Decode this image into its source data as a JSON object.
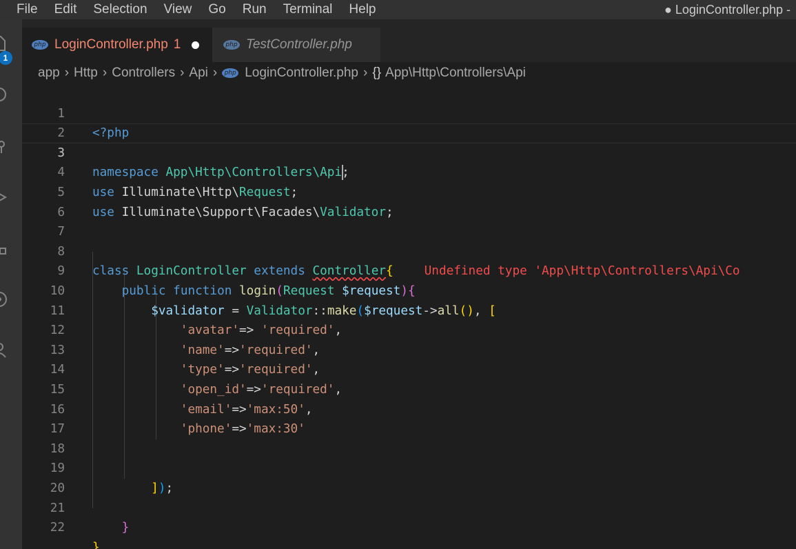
{
  "menu": {
    "items": [
      "File",
      "Edit",
      "Selection",
      "View",
      "Go",
      "Run",
      "Terminal",
      "Help"
    ],
    "window_title": "● LoginController.php -"
  },
  "activity_bar": {
    "badge_count": "1",
    "icons": [
      "explorer-icon",
      "search-icon",
      "source-control-icon",
      "run-debug-icon",
      "extensions-icon",
      "remote-icon",
      "accounts-icon"
    ]
  },
  "tabs": [
    {
      "icon": "php",
      "label": "LoginController.php",
      "problems": "1",
      "dirty": true,
      "active": true
    },
    {
      "icon": "php",
      "label": "TestController.php",
      "active": false
    }
  ],
  "breadcrumb": {
    "segments": [
      "app",
      "Http",
      "Controllers",
      "Api"
    ],
    "file_icon": "php",
    "file": "LoginController.php",
    "symbol_icon": "{}",
    "symbol": "App\\Http\\Controllers\\Api"
  },
  "editor": {
    "current_line": 3,
    "line_numbers": [
      "1",
      "2",
      "3",
      "4",
      "5",
      "6",
      "7",
      "8",
      "9",
      "10",
      "11",
      "12",
      "13",
      "14",
      "15",
      "16",
      "17",
      "18",
      "19",
      "20",
      "21",
      "22"
    ],
    "code": {
      "l1_open": "<?php",
      "l3_keyword": "namespace",
      "l3_ns": "App\\Http\\Controllers\\Api",
      "l3_semi": ";",
      "l4_use": "use",
      "l4_path": "Illuminate\\Http\\",
      "l4_class": "Request",
      "l4_semi": ";",
      "l5_use": "use",
      "l5_path": "Illuminate\\Support\\Facades\\",
      "l5_class": "Validator",
      "l5_semi": ";",
      "l8_class_kw": "class",
      "l8_name": "LoginController",
      "l8_extends": "extends",
      "l8_parent": "Controller",
      "l8_brace": "{",
      "l8_diagnostic": "Undefined type 'App\\Http\\Controllers\\Api\\Co",
      "l9_public": "public",
      "l9_function": "function",
      "l9_name": "login",
      "l9_paren_open": "(",
      "l9_type": "Request",
      "l9_param": "$request",
      "l9_paren_close": ")",
      "l9_brace": "{",
      "l10_var": "$validator",
      "l10_eq": " = ",
      "l10_class": "Validator",
      "l10_scope": "::",
      "l10_method": "make",
      "l10_paren": "(",
      "l10_arg": "$request",
      "l10_arrow": "->",
      "l10_all": "all",
      "l10_all_parens": "()",
      "l10_comma": ", ",
      "l10_bracket": "[",
      "rules": [
        {
          "key": "'avatar'",
          "arrow": "=> ",
          "value": "'required'",
          "end": ","
        },
        {
          "key": "'name'",
          "arrow": "=>",
          "value": "'required'",
          "end": ","
        },
        {
          "key": "'type'",
          "arrow": "=>",
          "value": "'required'",
          "end": ","
        },
        {
          "key": "'open_id'",
          "arrow": "=>",
          "value": "'required'",
          "end": ","
        },
        {
          "key": "'email'",
          "arrow": "=>",
          "value": "'max:50'",
          "end": ","
        },
        {
          "key": "'phone'",
          "arrow": "=>",
          "value": "'max:30'",
          "end": ""
        }
      ],
      "l19_bracket": "]",
      "l19_paren": ")",
      "l19_semi": ";",
      "l21_brace": "}",
      "l22_brace": "}"
    }
  },
  "colors": {
    "keyword": "#569cd6",
    "type": "#4ec9b0",
    "function": "#dcdcaa",
    "variable": "#9cdcfe",
    "string": "#ce9178",
    "error": "#f14c4c",
    "tab_modified": "#f48771"
  }
}
